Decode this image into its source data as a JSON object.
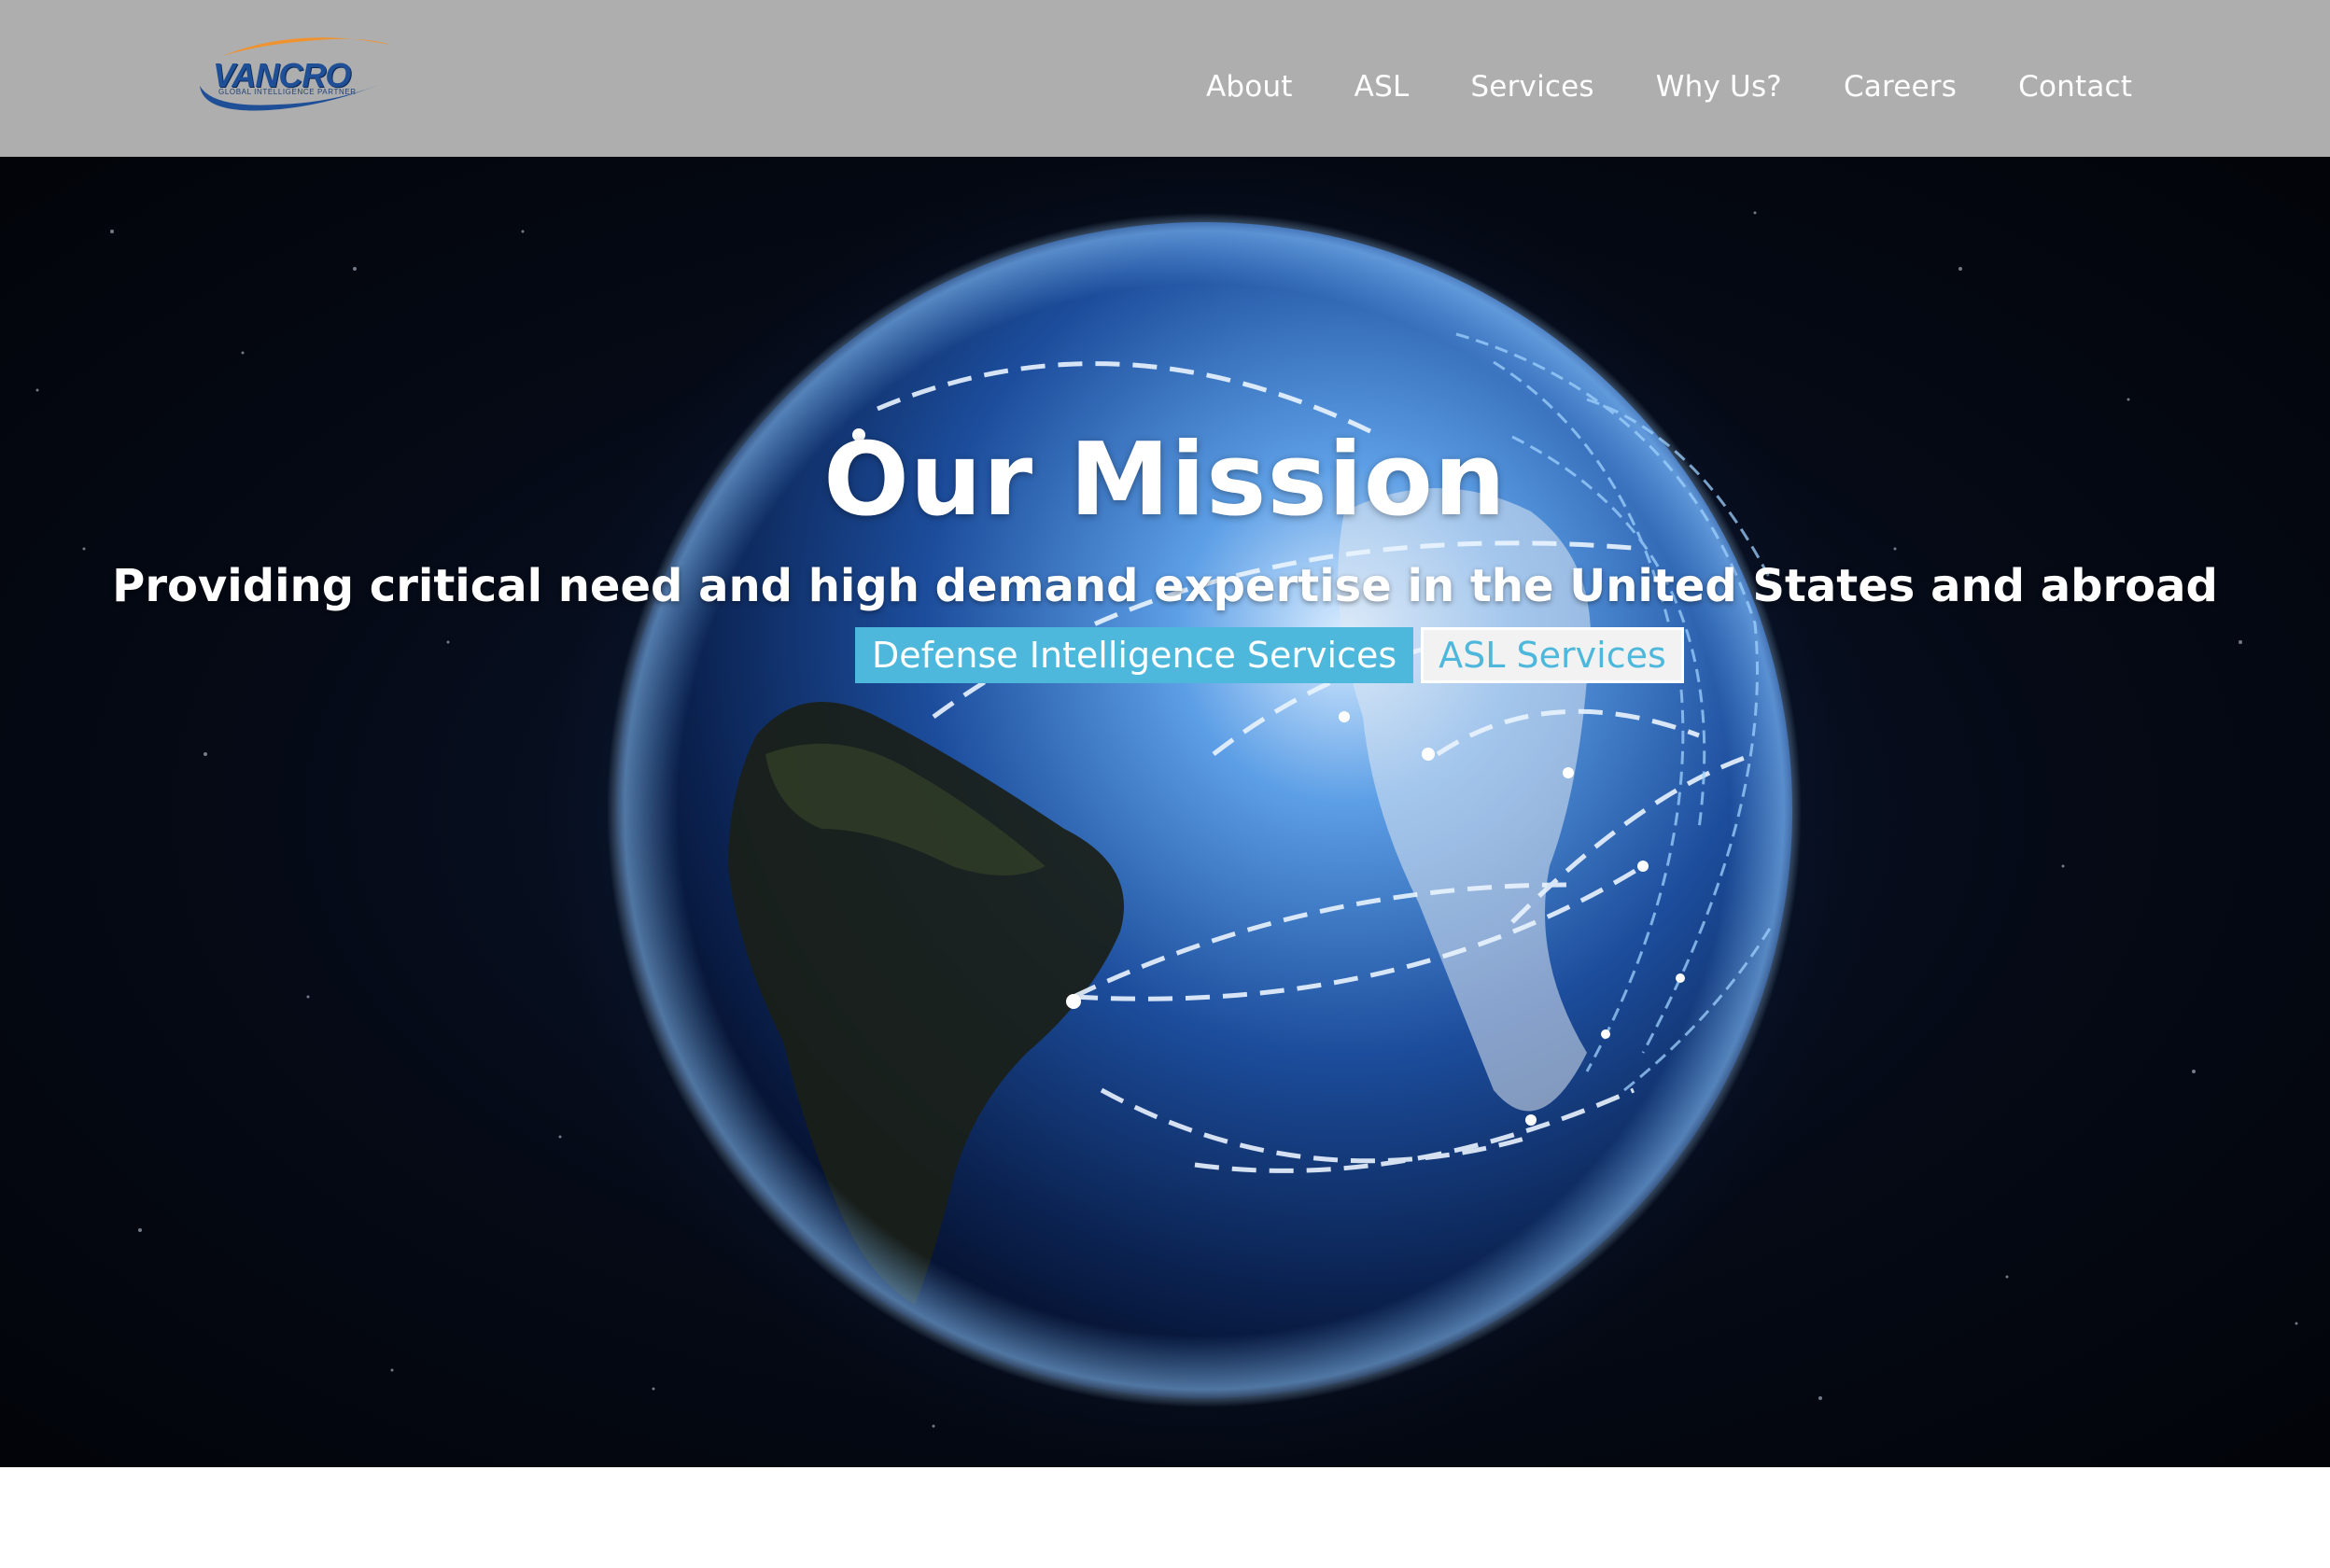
{
  "header": {
    "logo": {
      "name": "VANCRO",
      "tagline": "GLOBAL INTELLIGENCE PARTNER"
    },
    "nav": [
      "About",
      "ASL",
      "Services",
      "Why Us?",
      "Careers",
      "Contact"
    ]
  },
  "hero": {
    "title": "Our Mission",
    "subtitle": "Providing critical need and high demand expertise in the United States and abroad",
    "buttons": {
      "primary": "Defense Intelligence Services",
      "secondary": "ASL Services"
    },
    "background": "earth-globe-network-image"
  },
  "colors": {
    "header_bg": "#aeaeae",
    "accent": "#4db8dc",
    "logo_blue": "#1f4f97",
    "logo_orange": "#f0922d"
  }
}
